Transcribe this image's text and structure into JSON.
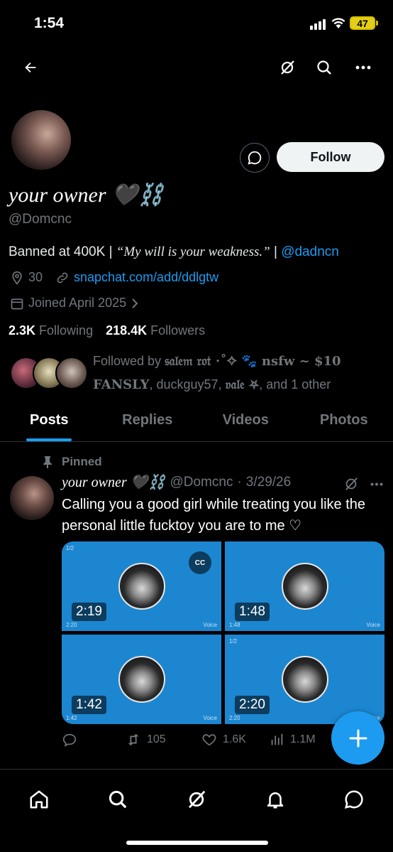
{
  "status_bar": {
    "time": "1:54",
    "battery": "47"
  },
  "header": {
    "back_icon": "arrow-left-icon",
    "grok_icon": "grok-icon",
    "search_icon": "search-icon",
    "more_icon": "more-icon"
  },
  "profile": {
    "display_name": "your owner 🖤⛓️",
    "handle": "@Domcnc",
    "follow_label": "Follow",
    "bio_prefix": "Banned at 400K | ",
    "bio_quote": "“My will is your weakness.”",
    "bio_sep": " | ",
    "bio_mention": "@dadncn",
    "location": "30",
    "website": "snapchat.com/add/ddlgtw",
    "joined": "Joined April 2025",
    "following_count": "2.3K",
    "following_label": "Following",
    "followers_count": "218.4K",
    "followers_label": "Followers",
    "followed_by_prefix": "Followed by ",
    "followed_by_name1": "𝔰𝔞𝔩𝔢𝔪 𝔯𝔬𝔱 ⋅˚✧ 🐾 nsfw ~ $10 FANSLY",
    "followed_by_mid": ", duckguy57, ",
    "followed_by_name2": "𝔳𝔞𝔩𝔢 ⛧",
    "followed_by_suffix": ", and 1 other"
  },
  "tabs": [
    "Posts",
    "Replies",
    "Videos",
    "Photos"
  ],
  "post": {
    "pinned_label": "Pinned",
    "author": "your owner 🖤⛓️",
    "handle": "@Domcnc",
    "dot": "·",
    "date": "3/29/26",
    "text": "Calling you a good girl while treating you like the personal little fucktoy you are to me ♡",
    "media": [
      {
        "duration": "2:19",
        "page": "1/2",
        "small_time": "2:20",
        "voice": "Voice",
        "cc": "CC"
      },
      {
        "duration": "1:48",
        "small_time": "1:48",
        "voice": "Voice"
      },
      {
        "duration": "1:42",
        "small_time": "1:42",
        "voice": "Voice"
      },
      {
        "duration": "2:20",
        "page": "1/2",
        "small_time": "2:20",
        "voice": "Voice"
      }
    ],
    "reposts": "105",
    "likes": "1.6K",
    "views": "1.1M"
  },
  "bottom_nav": [
    "home-icon",
    "search-icon",
    "grok-icon",
    "notifications-icon",
    "messages-icon"
  ]
}
